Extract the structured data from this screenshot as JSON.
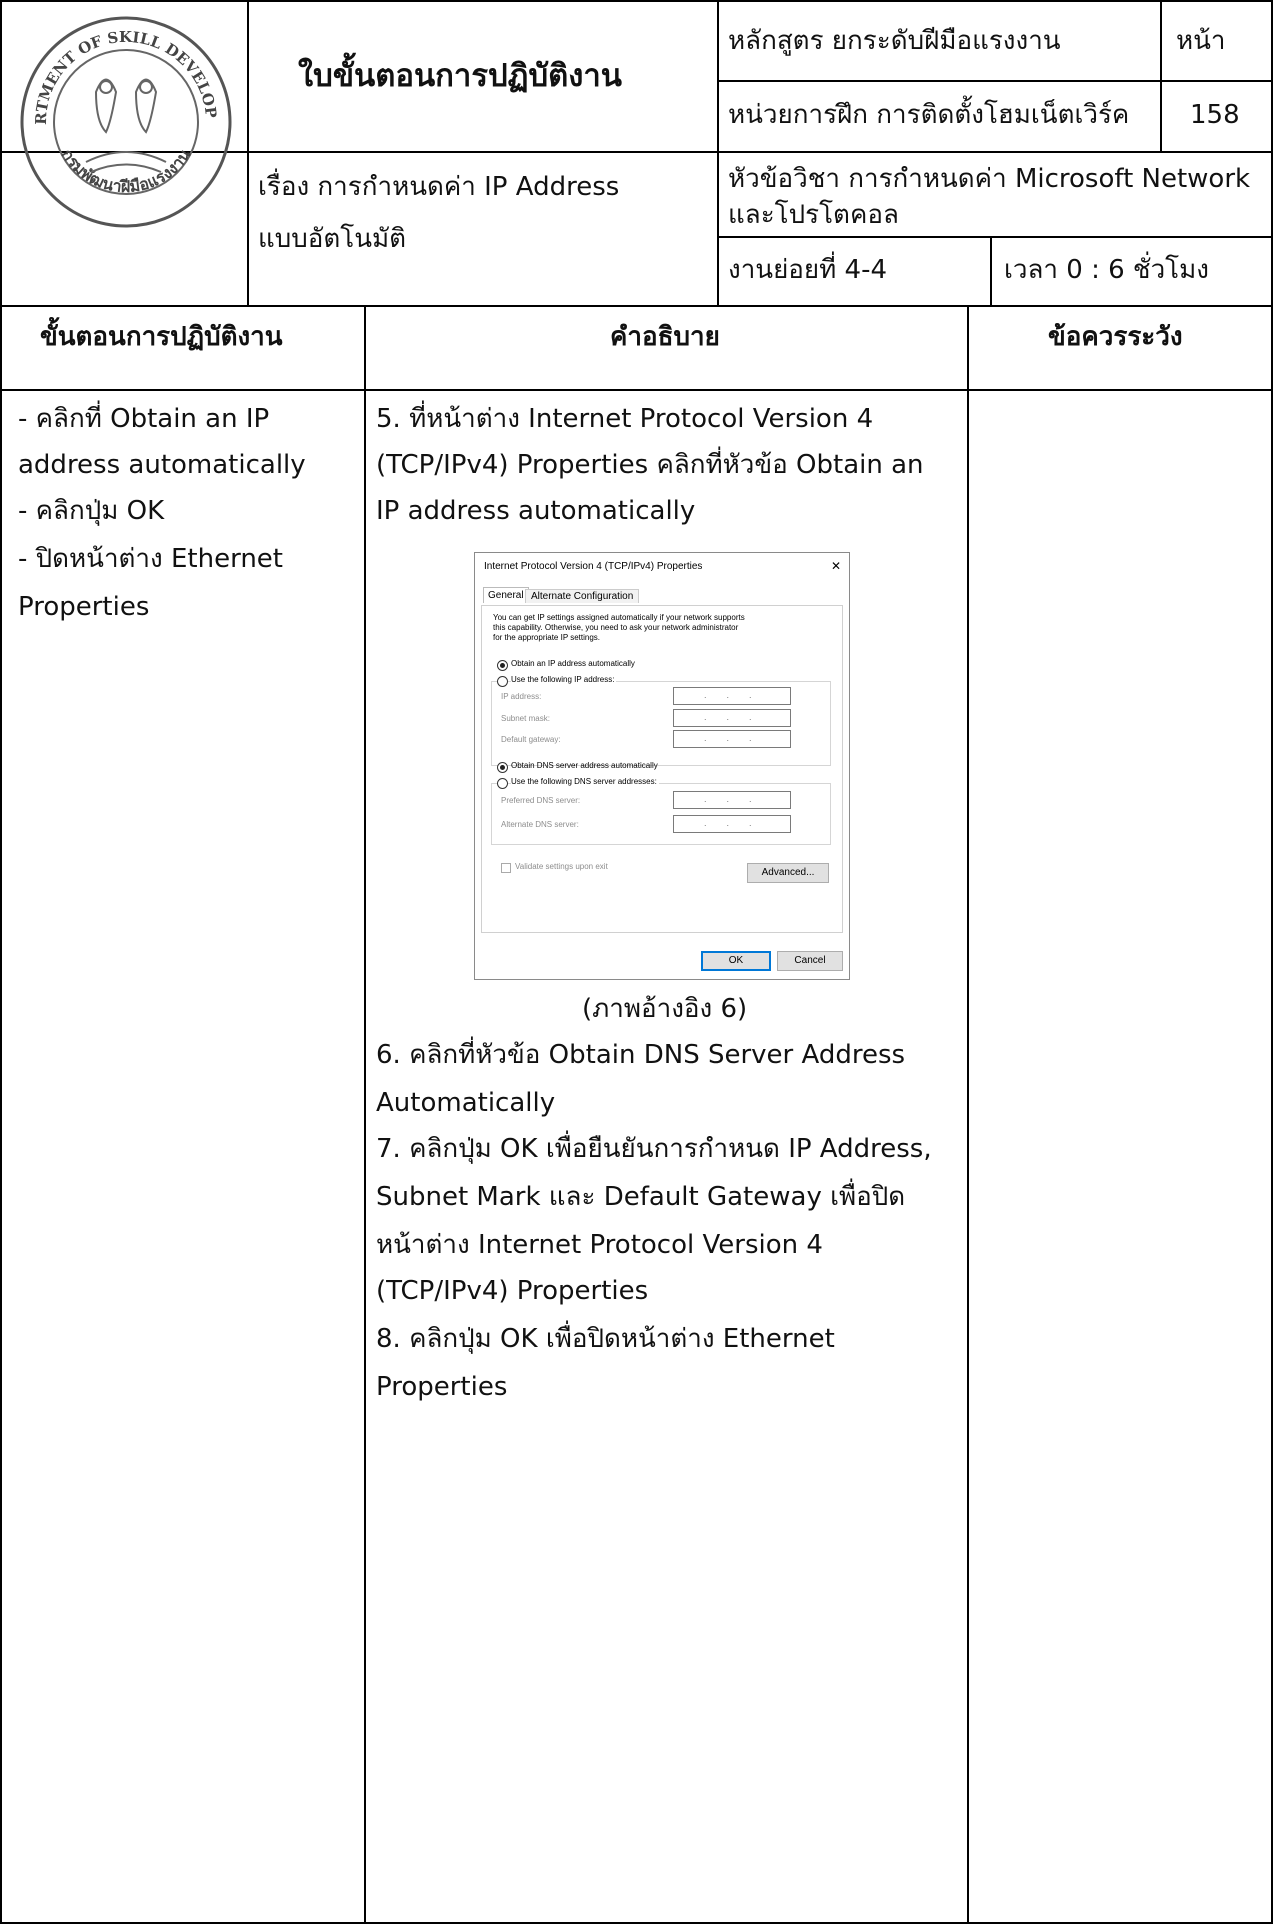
{
  "header": {
    "doc_title": "ใบขั้นตอนการปฏิบัติงาน",
    "topic_line1": "เรื่อง การกำหนดค่า IP Address",
    "topic_line2": "แบบอัตโนมัติ",
    "course": "หลักสูตร ยกระดับฝีมือแรงงาน",
    "page_label": "หน้า",
    "unit": "หน่วยการฝึก การติดตั้งโฮมเน็ตเวิร์ค",
    "page_number": "158",
    "subject_line1": "หัวข้อวิชา การกำหนดค่า Microsoft Network",
    "subject_line2": "และโปรโตคอล",
    "subtask": "งานย่อยที่   4-4",
    "time": "เวลา  0  :  6 ชั่วโมง",
    "logo_text": "DEPARTMENT OF SKILL DEVELOPMENT กรมพัฒนาฝีมือแรงงาน"
  },
  "columns": {
    "steps": "ขั้นตอนการปฏิบัติงาน",
    "description": "คำอธิบาย",
    "caution": "ข้อควรระวัง"
  },
  "steps": [
    "- คลิกที่ Obtain an IP",
    "address automatically",
    "- คลิกปุ่ม OK",
    "- ปิดหน้าต่าง Ethernet",
    "Properties"
  ],
  "description_top": [
    "5. ที่หน้าต่าง Internet Protocol Version 4",
    "(TCP/IPv4) Properties คลิกที่หัวข้อ Obtain an",
    "IP address automatically"
  ],
  "caption": "(ภาพอ้างอิง 6)",
  "description_bottom": [
    "6. คลิกที่หัวข้อ Obtain DNS Server Address",
    "Automatically",
    "7. คลิกปุ่ม OK เพื่อยืนยันการกำหนด IP Address,",
    "Subnet Mark และ Default Gateway เพื่อปิด",
    "หน้าต่าง Internet Protocol Version 4",
    "(TCP/IPv4) Properties",
    "8. คลิกปุ่ม OK เพื่อปิดหน้าต่าง Ethernet",
    "Properties"
  ],
  "dialog": {
    "title": "Internet Protocol Version 4 (TCP/IPv4) Properties",
    "close": "✕",
    "tabs": [
      "General",
      "Alternate Configuration"
    ],
    "info": [
      "You can get IP settings assigned automatically if your network supports",
      "this capability. Otherwise, you need to ask your network administrator",
      "for the appropriate IP settings."
    ],
    "radio_auto_ip": "Obtain an IP address automatically",
    "radio_manual_ip": "Use the following IP address:",
    "ip_address": "IP address:",
    "subnet_mask": "Subnet mask:",
    "default_gateway": "Default gateway:",
    "radio_auto_dns": "Obtain DNS server address automatically",
    "radio_manual_dns": "Use the following DNS server addresses:",
    "preferred_dns": "Preferred DNS server:",
    "alternate_dns": "Alternate DNS server:",
    "validate": "Validate settings upon exit",
    "advanced": "Advanced...",
    "ok": "OK",
    "cancel": "Cancel",
    "ip_placeholder": "..."
  }
}
